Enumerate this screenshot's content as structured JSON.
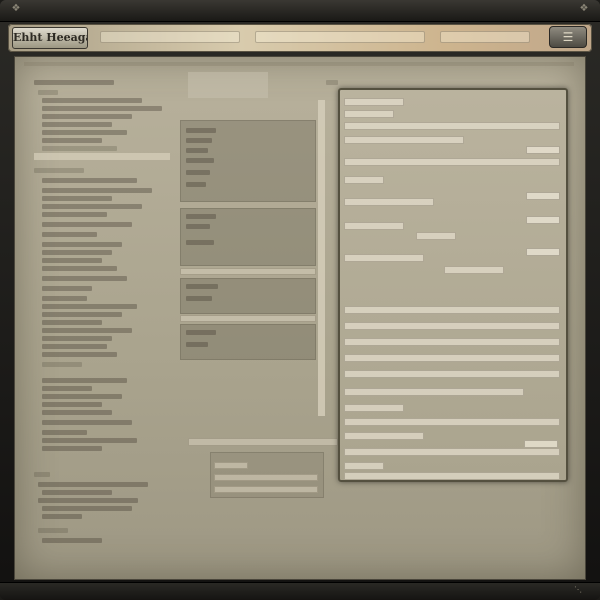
{
  "window": {
    "title": "",
    "corner_left_icon": "ornament-icon",
    "corner_right_icon": "ornament-icon"
  },
  "toolbar": {
    "logo_text": "Ehht Heeagan",
    "menu_icon": "menu-icon"
  },
  "right_panel": {
    "section_label": ""
  },
  "statusbar": {
    "text": "",
    "icon": "resize-grip-icon"
  },
  "colors": {
    "frame": "#1c1b18",
    "toolbar_accent": "#d8cbad",
    "content_bg": "#b0a993",
    "panel_border": "#54503f"
  }
}
